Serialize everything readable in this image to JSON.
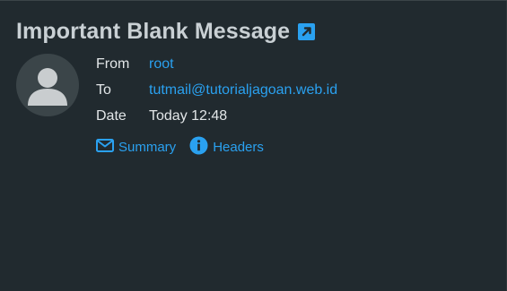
{
  "message": {
    "title": "Important Blank Message",
    "popout_icon": "external-link-icon"
  },
  "sender": {
    "avatar_icon": "user-avatar-icon",
    "from_label": "From",
    "from_value": "root",
    "to_label": "To",
    "to_value": "tutmail@tutorialjagoan.web.id",
    "date_label": "Date",
    "date_value": "Today 12:48"
  },
  "actions": {
    "summary_label": "Summary",
    "summary_icon": "envelope-icon",
    "headers_label": "Headers",
    "headers_icon": "info-icon"
  },
  "colors": {
    "background": "#212a2f",
    "accent": "#2aa1f0",
    "title": "#c9d0d4",
    "text": "#e2e6e8"
  }
}
